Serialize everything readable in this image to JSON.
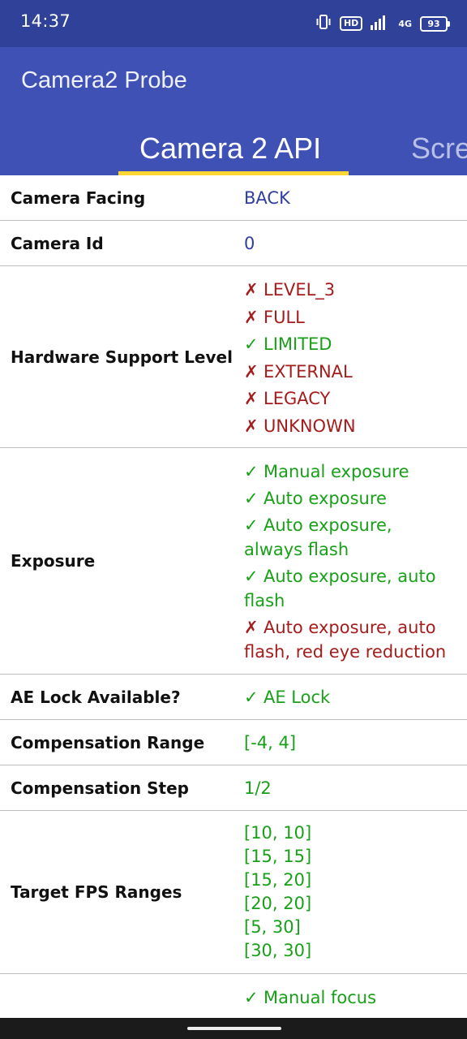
{
  "status_bar": {
    "time": "14:37",
    "hd": "HD",
    "network": "4G",
    "battery": "93",
    "icons": [
      "vibrate-icon",
      "hd-icon",
      "signal-icon",
      "network-4g-icon",
      "battery-icon"
    ]
  },
  "app_bar": {
    "title": "Camera2 Probe"
  },
  "tabs": [
    {
      "label": "Camera 2 API",
      "active": true
    },
    {
      "label": "Scre",
      "active": false
    }
  ],
  "colors": {
    "status_bar": "#2f4198",
    "primary": "#3f51b5",
    "indicator": "#fdd835",
    "supported": "#19a019",
    "unsupported": "#a51c1c",
    "value_neutral": "#303f9f"
  },
  "rows": [
    {
      "label": "Camera Facing",
      "values": [
        {
          "text": "BACK",
          "status": "neutral"
        }
      ]
    },
    {
      "label": "Camera Id",
      "values": [
        {
          "text": "0",
          "status": "neutral"
        }
      ]
    },
    {
      "label": "Hardware Support Level",
      "values": [
        {
          "text": "LEVEL_3",
          "status": "bad"
        },
        {
          "text": "FULL",
          "status": "bad"
        },
        {
          "text": "LIMITED",
          "status": "ok"
        },
        {
          "text": "EXTERNAL",
          "status": "bad"
        },
        {
          "text": "LEGACY",
          "status": "bad"
        },
        {
          "text": "UNKNOWN",
          "status": "bad"
        }
      ]
    },
    {
      "label": "Exposure",
      "values": [
        {
          "text": "Manual exposure",
          "status": "ok"
        },
        {
          "text": "Auto exposure",
          "status": "ok"
        },
        {
          "text": "Auto exposure, always flash",
          "status": "ok"
        },
        {
          "text": "Auto exposure, auto flash",
          "status": "ok"
        },
        {
          "text": "Auto exposure, auto flash, red eye reduction",
          "status": "bad"
        }
      ]
    },
    {
      "label": "AE Lock Available?",
      "values": [
        {
          "text": "AE Lock",
          "status": "ok"
        }
      ]
    },
    {
      "label": "Compensation Range",
      "values": [
        {
          "text": "[-4, 4]",
          "status": "plain-ok"
        }
      ]
    },
    {
      "label": "Compensation Step",
      "values": [
        {
          "text": "1/2",
          "status": "plain-ok"
        }
      ]
    },
    {
      "label": "Target FPS Ranges",
      "values": [
        {
          "text": "[10, 10]",
          "status": "plain-ok"
        },
        {
          "text": "[15, 15]",
          "status": "plain-ok"
        },
        {
          "text": "[15, 20]",
          "status": "plain-ok"
        },
        {
          "text": "[20, 20]",
          "status": "plain-ok"
        },
        {
          "text": "[5, 30]",
          "status": "plain-ok"
        },
        {
          "text": "[30, 30]",
          "status": "plain-ok"
        }
      ]
    },
    {
      "label": "",
      "values": [
        {
          "text": "Manual focus",
          "status": "ok"
        }
      ]
    }
  ]
}
